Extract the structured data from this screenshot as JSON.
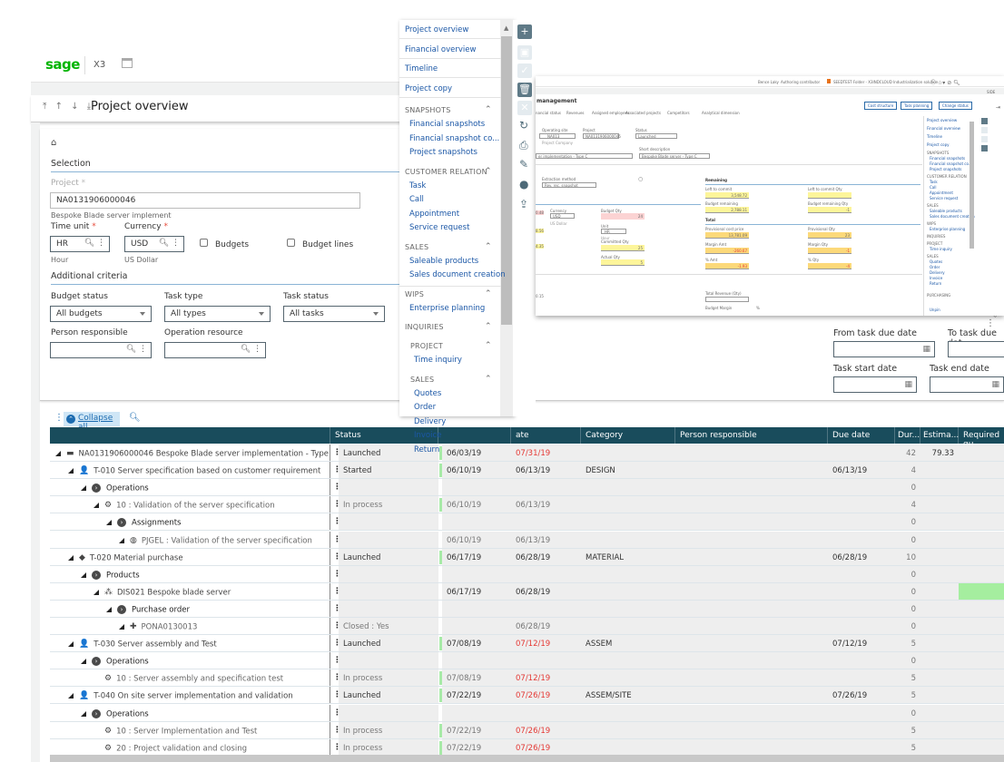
{
  "app": {
    "brand": "sage",
    "product": "X3",
    "calendar_icon": "calendar-icon"
  },
  "header": {
    "nav_arrows": "⤒ ↑ ↓ ⤓",
    "title": "Project overview"
  },
  "selection": {
    "home_icon": "home-icon",
    "section_title": "Selection",
    "project_label": "Project",
    "project_value": "NA0131906000046",
    "project_desc": "Bespoke Blade server implement",
    "time_unit_label": "Time unit",
    "time_unit_value": "HR",
    "time_unit_desc": "Hour",
    "currency_label": "Currency",
    "currency_value": "USD",
    "currency_desc": "US Dollar",
    "budgets_label": "Budgets",
    "budget_lines_label": "Budget lines",
    "required_mark": "*"
  },
  "additional": {
    "title": "Additional criteria",
    "budget_status_label": "Budget status",
    "budget_status_value": "All budgets",
    "task_type_label": "Task type",
    "task_type_value": "All types",
    "task_status_label": "Task status",
    "task_status_value": "All tasks",
    "person_label": "Person responsible",
    "person_value": "",
    "resource_label": "Operation resource",
    "resource_value": "",
    "from_due_label": "From task due date",
    "to_due_label": "To task due dat",
    "start_label": "Task start date",
    "end_label": "Task end date"
  },
  "table_toolbar": {
    "collapse_label": "Collapse all"
  },
  "table": {
    "columns": [
      "",
      "Status",
      "",
      "ate",
      "Category",
      "Person responsible",
      "Due date",
      "Dur...",
      "Estima...",
      "Required qu"
    ],
    "rows": [
      {
        "indent": 0,
        "icon": "folder-icon",
        "glyph": "▬",
        "label": "NA0131906000046 Bespoke Blade server implementation - Type",
        "status": "Launched",
        "start": "06/03/19",
        "end": "07/31/19",
        "end_red": true,
        "category": "",
        "due": "",
        "dur": "42",
        "est": "79.33",
        "bold": true,
        "gbar": true
      },
      {
        "indent": 1,
        "icon": "person-icon",
        "glyph": "👤",
        "label": "T-010 Server specification based on customer requirement",
        "status": "Started",
        "start": "06/10/19",
        "end": "06/13/19",
        "end_red": false,
        "category": "DESIGN",
        "due": "06/13/19",
        "dur": "4",
        "est": "",
        "bold": true,
        "gbar": true
      },
      {
        "indent": 2,
        "icon": "group-circle-icon",
        "glyph": "›",
        "label": "Operations",
        "status": "",
        "start": "",
        "end": "",
        "category": "",
        "due": "",
        "dur": "0",
        "est": "",
        "group": true
      },
      {
        "indent": 3,
        "icon": "gear-icon",
        "glyph": "⚙",
        "label": "10 : Validation of the server specification",
        "status": "In process",
        "start": "06/10/19",
        "end": "06/13/19",
        "end_red": false,
        "category": "",
        "due": "",
        "dur": "4",
        "est": "",
        "dim": true,
        "gbar": true
      },
      {
        "indent": 4,
        "icon": "group-circle-icon",
        "glyph": "›",
        "label": "Assignments",
        "status": "",
        "start": "",
        "end": "",
        "category": "",
        "due": "",
        "dur": "0",
        "est": "",
        "group": true
      },
      {
        "indent": 5,
        "icon": "resource-icon",
        "glyph": "◍",
        "label": "PJGEL : Validation of the server specification",
        "status": "",
        "start": "06/10/19",
        "end": "06/13/19",
        "end_red": false,
        "category": "",
        "due": "",
        "dur": "0",
        "est": "",
        "dim": true
      },
      {
        "indent": 1,
        "icon": "box-icon",
        "glyph": "◆",
        "label": "T-020 Material purchase",
        "status": "Launched",
        "start": "06/17/19",
        "end": "06/28/19",
        "end_red": false,
        "category": "MATERIAL",
        "due": "06/28/19",
        "dur": "10",
        "est": "",
        "bold": true,
        "gbar": true
      },
      {
        "indent": 2,
        "icon": "group-circle-icon",
        "glyph": "›",
        "label": "Products",
        "status": "",
        "start": "",
        "end": "",
        "category": "",
        "due": "",
        "dur": "0",
        "est": "",
        "group": true
      },
      {
        "indent": 3,
        "icon": "hierarchy-icon",
        "glyph": "⁂",
        "label": "DIS021 Bespoke blade server",
        "status": "",
        "start": "06/17/19",
        "end": "06/28/19",
        "end_red": false,
        "category": "",
        "due": "",
        "dur": "0",
        "est": "",
        "bold": true,
        "greenreq": true
      },
      {
        "indent": 4,
        "icon": "group-circle-icon",
        "glyph": "›",
        "label": "Purchase order",
        "status": "",
        "start": "",
        "end": "",
        "category": "",
        "due": "",
        "dur": "0",
        "est": "",
        "group": true
      },
      {
        "indent": 5,
        "icon": "purchase-order-icon",
        "glyph": "✚",
        "label": "PONA0130013",
        "status": "Closed : Yes",
        "start": "",
        "end": "06/28/19",
        "end_red": false,
        "category": "",
        "due": "",
        "dur": "0",
        "est": "",
        "dim": true
      },
      {
        "indent": 1,
        "icon": "person-icon",
        "glyph": "👤",
        "label": "T-030 Server assembly and Test",
        "status": "Launched",
        "start": "07/08/19",
        "end": "07/12/19",
        "end_red": true,
        "category": "ASSEM",
        "due": "07/12/19",
        "dur": "5",
        "est": "",
        "bold": true,
        "gbar": true
      },
      {
        "indent": 2,
        "icon": "group-circle-icon",
        "glyph": "›",
        "label": "Operations",
        "status": "",
        "start": "",
        "end": "",
        "category": "",
        "due": "",
        "dur": "0",
        "est": "",
        "group": true
      },
      {
        "indent": 3,
        "icon": "gear-icon",
        "glyph": "⚙",
        "label": "10 : Server assembly and specification test",
        "status": "In process",
        "start": "07/08/19",
        "end": "07/12/19",
        "end_red": true,
        "category": "",
        "due": "",
        "dur": "5",
        "est": "",
        "dim": true,
        "notri": true,
        "gbar": true
      },
      {
        "indent": 1,
        "icon": "person-icon",
        "glyph": "👤",
        "label": "T-040 On site server implementation and validation",
        "status": "Launched",
        "start": "07/22/19",
        "end": "07/26/19",
        "end_red": true,
        "category": "ASSEM/SITE",
        "due": "07/26/19",
        "dur": "5",
        "est": "",
        "bold": true,
        "gbar": true
      },
      {
        "indent": 2,
        "icon": "group-circle-icon",
        "glyph": "›",
        "label": "Operations",
        "status": "",
        "start": "",
        "end": "",
        "category": "",
        "due": "",
        "dur": "0",
        "est": "",
        "group": true
      },
      {
        "indent": 3,
        "icon": "gear-icon",
        "glyph": "⚙",
        "label": "10 : Server Implementation and Test",
        "status": "In process",
        "start": "07/22/19",
        "end": "07/26/19",
        "end_red": true,
        "category": "",
        "due": "",
        "dur": "5",
        "est": "",
        "dim": true,
        "notri": true,
        "gbar": true
      },
      {
        "indent": 3,
        "icon": "gear-icon",
        "glyph": "⚙",
        "label": "20 : Project validation and closing",
        "status": "In process",
        "start": "07/22/19",
        "end": "07/26/19",
        "end_red": true,
        "category": "",
        "due": "",
        "dur": "5",
        "est": "",
        "dim": true,
        "notri": true,
        "gbar": true
      }
    ]
  },
  "menu": {
    "top_items": [
      "Project overview",
      "Financial overview",
      "Timeline",
      "Project copy"
    ],
    "sections": [
      {
        "title": "SNAPSHOTS",
        "items": [
          "Financial snapshots",
          "Financial snapshot co...",
          "Project snapshots"
        ]
      },
      {
        "title": "CUSTOMER RELATION",
        "items": [
          "Task",
          "Call",
          "Appointment",
          "Service request"
        ]
      },
      {
        "title": "SALES",
        "items": [
          "Saleable products",
          "Sales document creation"
        ]
      },
      {
        "title": "WIPS",
        "items": [
          "Enterprise planning"
        ]
      },
      {
        "title": "INQUIRIES",
        "items": []
      },
      {
        "title": "PROJECT",
        "items": [
          "Time inquiry"
        ]
      },
      {
        "title": "SALES",
        "items": [
          "Quotes",
          "Order",
          "Delivery",
          "Invoice",
          "Return"
        ]
      }
    ]
  },
  "action_rail": [
    "add-icon",
    "save-icon",
    "check-icon",
    "delete-icon",
    "close-icon",
    "refresh-icon",
    "print-icon",
    "attachment-icon",
    "comment-icon",
    "share-icon"
  ],
  "embedded": {
    "user": "Bence Laky",
    "role": "Authoring contributor",
    "folder": "SEEDTEST Folder - X3INDCLOUD Industrialization solution",
    "side": "SIDE",
    "title": "management",
    "tabs": [
      "nancial status",
      "Revenues",
      "Assigned employees",
      "Associated projects",
      "Competitors",
      "Analytical dimension"
    ],
    "buttons": [
      "Cost structure",
      "Task planning",
      "Change status"
    ],
    "operating_site_label": "Operating site",
    "operating_site": "NA013",
    "project_label": "Project",
    "project": "NA0131906000046",
    "status_label": "Status",
    "status": "Launched",
    "project_company": "Project Company",
    "short_desc_label": "Short description",
    "impl": "er implementation - Type C",
    "short_desc": "Bespoke Blade server - Type C",
    "extraction_label": "Extraction method",
    "extraction": "Rev. rec. snapshot",
    "currency_label": "Currency",
    "currency": "USD",
    "currency_desc": "US Dollar",
    "budget_qty_label": "Budget Qty",
    "budget_qty": "24",
    "unit_label": "Unit",
    "unit": "HR",
    "unit_desc": "Hour",
    "committed_qty_label": "Committed Qty",
    "committed_qty": "25",
    "actual_qty_label": "Actual Qty",
    "actual_qty": "5",
    "left_vals": [
      "0.48",
      "8.56",
      "4.35",
      "0.15"
    ],
    "remaining_title": "Remaining",
    "left_commit_label": "Left to commit",
    "left_commit": "3,548.72",
    "left_commit_qty_label": "Left to commit Qty",
    "budget_remaining_label": "Budget remaining",
    "budget_remaining": "2,788.11",
    "budget_remaining_qty_label": "Budget remaining Qty",
    "budget_remaining_qty": "-1",
    "total_title": "Total",
    "prov_cost_label": "Provisional cost price",
    "prov_cost": "13,781.09",
    "prov_qty_label": "Provisional Qty",
    "prov_qty": "23",
    "margin_amt_label": "Margin Amt",
    "margin_amt": "-260.67",
    "margin_qty_label": "Margin Qty",
    "margin_qty": "-1",
    "pct_amt_label": "% Amt",
    "pct_amt": "-1.93",
    "pct_qty_label": "% Qty",
    "pct_qty": "-4",
    "total_rev_label": "Total Revenue (Qty)",
    "budget_margin_label": "Budget Margin",
    "pct_label": "%",
    "unpin": "Unpin",
    "purchasing": "PURCHASING"
  }
}
